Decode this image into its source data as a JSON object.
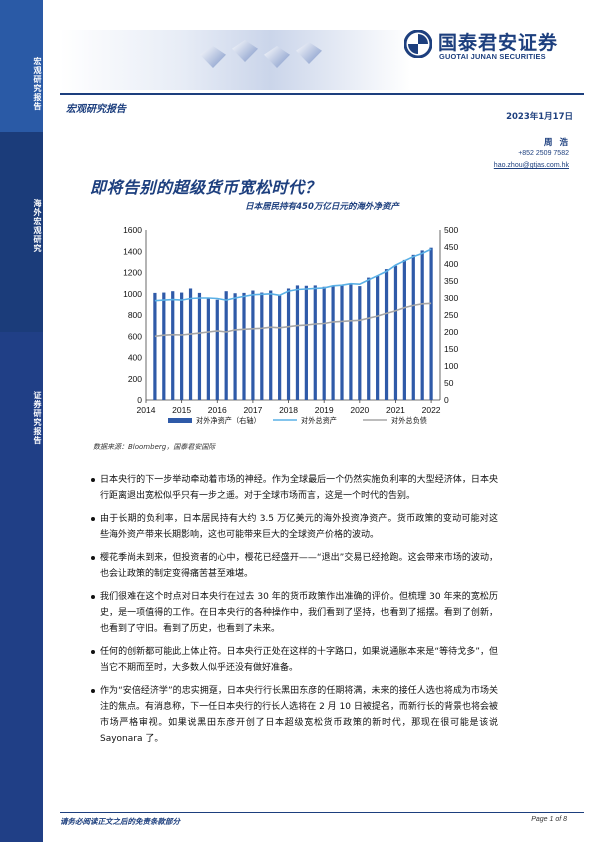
{
  "sidebar": {
    "section1": "宏观研究报告",
    "section2": "海外宏观研究",
    "section3": "证券研究报告"
  },
  "logo": {
    "cn": "国泰君安证券",
    "en": "GUOTAI JUNAN SECURITIES"
  },
  "header": {
    "report_type": "宏观研究报告",
    "date": "2023年1月17日",
    "author": "周 浩",
    "phone": "+852 2509 7582",
    "email": "hao.zhou@gtjas.com.hk"
  },
  "title": "即将告别的超级货币宽松时代？",
  "chart_data": {
    "type": "bar+line",
    "title": "日本居民持有450万亿日元的海外净资产",
    "x_ticks": [
      "2014",
      "2015",
      "2016",
      "2017",
      "2018",
      "2019",
      "2020",
      "2021",
      "2022"
    ],
    "x_range": [
      2014,
      2022.25
    ],
    "left_axis": {
      "ticks": [
        0,
        200,
        400,
        600,
        800,
        1000,
        1200,
        1400,
        1600
      ],
      "range": [
        0,
        1600
      ]
    },
    "right_axis": {
      "ticks": [
        0,
        50,
        100,
        150,
        200,
        250,
        300,
        350,
        400,
        450,
        500
      ],
      "range": [
        0,
        500
      ]
    },
    "x": [
      2014.25,
      2014.5,
      2014.75,
      2015.0,
      2015.25,
      2015.5,
      2015.75,
      2016.0,
      2016.25,
      2016.5,
      2016.75,
      2017.0,
      2017.25,
      2017.5,
      2017.75,
      2018.0,
      2018.25,
      2018.5,
      2018.75,
      2019.0,
      2019.25,
      2019.5,
      2019.75,
      2020.0,
      2020.25,
      2020.5,
      2020.75,
      2021.0,
      2021.25,
      2021.5,
      2021.75,
      2022.0
    ],
    "series": [
      {
        "name": "对外净资产（右轴）",
        "axis": "right",
        "type": "bar",
        "color": "#2f5aa8",
        "values": [
          315,
          316,
          320,
          316,
          328,
          315,
          300,
          295,
          320,
          314,
          315,
          322,
          316,
          322,
          308,
          328,
          337,
          336,
          337,
          333,
          336,
          338,
          342,
          335,
          360,
          365,
          385,
          395,
          412,
          427,
          440,
          448
        ]
      },
      {
        "name": "对外总资产",
        "axis": "left",
        "type": "line",
        "color": "#5ab0e6",
        "values": [
          935,
          940,
          945,
          940,
          955,
          960,
          960,
          955,
          940,
          960,
          975,
          990,
          995,
          1000,
          985,
          1025,
          1040,
          1045,
          1050,
          1055,
          1075,
          1080,
          1095,
          1090,
          1130,
          1170,
          1210,
          1270,
          1310,
          1350,
          1380,
          1420
        ]
      },
      {
        "name": "对外总负债",
        "axis": "left",
        "type": "line",
        "color": "#a6a6a6",
        "values": [
          600,
          610,
          615,
          612,
          620,
          630,
          640,
          650,
          640,
          660,
          665,
          670,
          675,
          685,
          680,
          690,
          700,
          705,
          715,
          720,
          735,
          740,
          745,
          750,
          770,
          790,
          815,
          840,
          870,
          890,
          905,
          910
        ]
      }
    ]
  },
  "source": "数据来源：Bloomberg，国泰君安国际",
  "bullets": [
    "日本央行的下一步举动牵动着市场的神经。作为全球最后一个仍然实施负利率的大型经济体，日本央行距离退出宽松似乎只有一步之遥。对于全球市场而言，这是一个时代的告别。",
    "由于长期的负利率，日本居民持有大约 3.5 万亿美元的海外投资净资产。货币政策的变动可能对这些海外资产带来长期影响，这也可能带来巨大的全球资产价格的波动。",
    "樱花季尚未到来，但投资者的心中，樱花已经盛开——“退出”交易已经抢跑。这会带来市场的波动，也会让政策的制定变得痛苦甚至难堪。",
    "我们很难在这个时点对日本央行在过去 30 年的货币政策作出准确的评价。但梳理 30 年来的宽松历史，是一项值得的工作。在日本央行的各种操作中，我们看到了坚持，也看到了摇摆。看到了创新，也看到了守旧。看到了历史，也看到了未来。",
    "任何的创新都可能此上体止符。日本央行正处在这样的十字路口，如果说通胀本来是“等待戈多”，但当它不期而至时，大多数人似乎还没有做好准备。",
    "作为“安倍经济学”的忠实拥趸，日本央行行长黑田东彦的任期将满，未来的接任人选也将成为市场关注的焦点。有消息称，下一任日本央行的行长人选将在 2 月 10 日被提名，而新行长的背景也将会被市场严格审视。如果说黑田东彦开创了日本超级宽松货币政策的新时代，那现在很可能是该说 Sayonara 了。"
  ],
  "footer": {
    "left": "请务必阅读正文之后的免责条款部分",
    "right": "Page 1 of 8"
  },
  "colors": {
    "brand": "#1d3f7e",
    "bar": "#2f5aa8",
    "line_assets": "#5ab0e6",
    "line_liabilities": "#a6a6a6"
  }
}
